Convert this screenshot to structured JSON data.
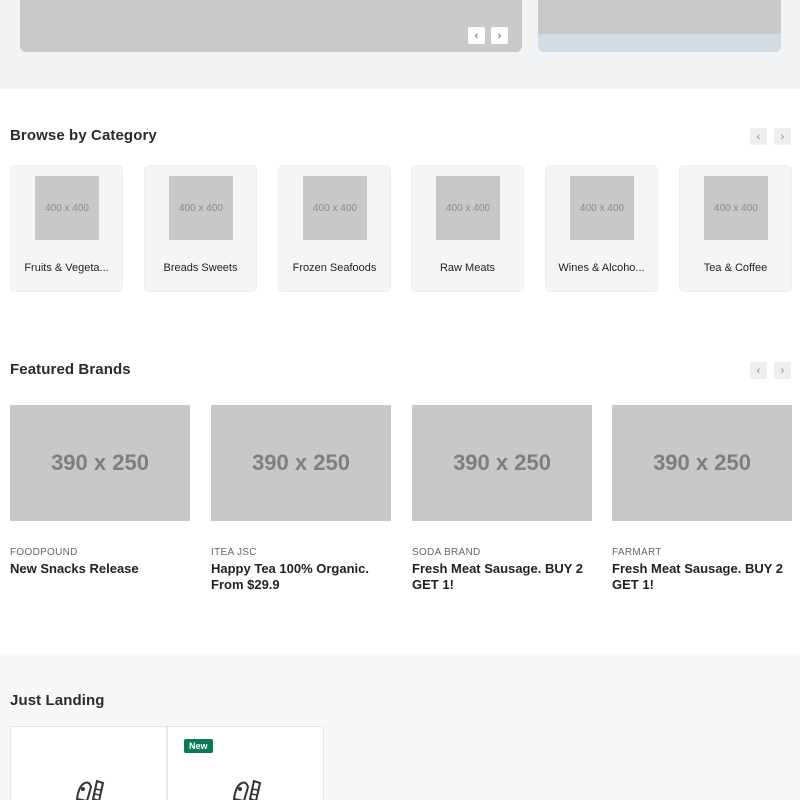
{
  "hero": {
    "prev_icon": "chevron-left-icon",
    "next_icon": "chevron-right-icon"
  },
  "categories": {
    "title": "Browse by Category",
    "items": [
      {
        "image_text": "400 x 400",
        "label": "Fruits & Vegeta..."
      },
      {
        "image_text": "400 x 400",
        "label": "Breads Sweets"
      },
      {
        "image_text": "400 x 400",
        "label": "Frozen Seafoods"
      },
      {
        "image_text": "400 x 400",
        "label": "Raw Meats"
      },
      {
        "image_text": "400 x 400",
        "label": "Wines & Alcoho..."
      },
      {
        "image_text": "400 x 400",
        "label": "Tea & Coffee"
      }
    ]
  },
  "brands": {
    "title": "Featured Brands",
    "items": [
      {
        "image_text": "390 x 250",
        "brand": "FOODPOUND",
        "title": "New Snacks Release"
      },
      {
        "image_text": "390 x 250",
        "brand": "ITEA JSC",
        "title": "Happy Tea 100% Organic. From $29.9"
      },
      {
        "image_text": "390 x 250",
        "brand": "SODA BRAND",
        "title": "Fresh Meat Sausage. BUY 2 GET 1!"
      },
      {
        "image_text": "390 x 250",
        "brand": "FARMART",
        "title": "Fresh Meat Sausage. BUY 2 GET 1!"
      }
    ]
  },
  "landing": {
    "title": "Just Landing",
    "products": [
      {
        "badge": "",
        "icon": "bread-basket-icon"
      },
      {
        "badge": "New",
        "icon": "bread-basket-icon"
      }
    ]
  },
  "colors": {
    "badge": "#0b7a5b",
    "placeholder": "#c8c8c8",
    "hero_bg": "#f2f3f4"
  }
}
